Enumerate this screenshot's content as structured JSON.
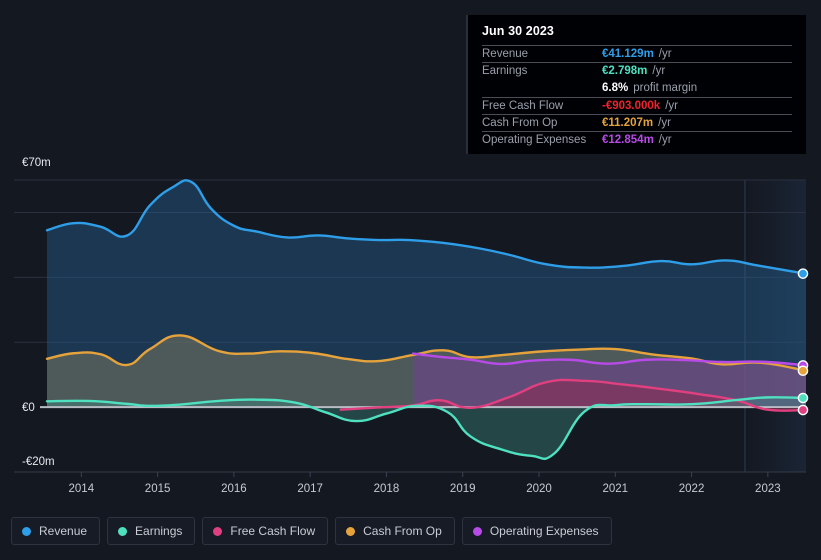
{
  "tooltip": {
    "date": "Jun 30 2023",
    "rows": [
      {
        "label": "Revenue",
        "value": "€41.129m",
        "unit": "/yr",
        "color": "#2f9ee8"
      },
      {
        "label": "Earnings",
        "value": "€2.798m",
        "unit": "/yr",
        "color": "#4fe0c0"
      },
      {
        "label": "",
        "value": "6.8%",
        "unit": "profit margin",
        "color": "#ffffff"
      },
      {
        "label": "Free Cash Flow",
        "value": "-€903.000k",
        "unit": "/yr",
        "color": "#f0222e"
      },
      {
        "label": "Cash From Op",
        "value": "€11.207m",
        "unit": "/yr",
        "color": "#e6a33c"
      },
      {
        "label": "Operating Expenses",
        "value": "€12.854m",
        "unit": "/yr",
        "color": "#b84ae8"
      }
    ]
  },
  "legend": {
    "items": [
      {
        "label": "Revenue",
        "color": "#2f9ee8"
      },
      {
        "label": "Earnings",
        "color": "#4fe0c0"
      },
      {
        "label": "Free Cash Flow",
        "color": "#e0407f"
      },
      {
        "label": "Cash From Op",
        "color": "#e6a33c"
      },
      {
        "label": "Operating Expenses",
        "color": "#b84ae8"
      }
    ]
  },
  "chart_data": {
    "type": "area",
    "title": "",
    "xlabel": "",
    "ylabel": "",
    "currency": "EUR",
    "grid": true,
    "legend_position": "bottom",
    "x_tick_labels": [
      "2014",
      "2015",
      "2016",
      "2017",
      "2018",
      "2019",
      "2020",
      "2021",
      "2022",
      "2023"
    ],
    "y_tick_labels": [
      "€70m",
      "€0",
      "-€20m"
    ],
    "ylim": [
      -20,
      70
    ],
    "y_gridline_values": [
      70,
      60,
      40,
      20,
      0,
      -20
    ],
    "zero_line": 0,
    "forecast_band_start_x": "2022.7",
    "series": [
      {
        "name": "Revenue",
        "color": "#2f9ee8",
        "fill": "rgba(37,99,150,0.42)",
        "x": [
          2013.55,
          2013.9,
          2014.25,
          2014.6,
          2014.9,
          2015.2,
          2015.45,
          2015.7,
          2016.0,
          2016.3,
          2016.7,
          2017.1,
          2017.5,
          2017.9,
          2018.3,
          2018.75,
          2019.2,
          2019.6,
          2020.1,
          2020.6,
          2021.1,
          2021.6,
          2022.0,
          2022.45,
          2022.9,
          2023.5
        ],
        "y": [
          54.5,
          56.7,
          55.6,
          52.9,
          62.2,
          67.8,
          69.3,
          61.2,
          55.9,
          54.1,
          52.3,
          52.9,
          52.0,
          51.5,
          51.5,
          50.6,
          49.0,
          47.0,
          44.0,
          43.0,
          43.5,
          45.0,
          44.0,
          45.2,
          43.5,
          41.1
        ]
      },
      {
        "name": "Cash From Op",
        "color": "#e6a33c",
        "fill": "rgba(120,118,95,0.55)",
        "x": [
          2013.55,
          2013.9,
          2014.25,
          2014.6,
          2014.9,
          2015.3,
          2015.8,
          2016.2,
          2016.6,
          2017.05,
          2017.5,
          2017.9,
          2018.35,
          2018.75,
          2019.1,
          2019.5,
          2020.0,
          2020.5,
          2021.0,
          2021.5,
          2022.0,
          2022.4,
          2022.9,
          2023.5
        ],
        "y": [
          14.9,
          16.6,
          16.3,
          13.0,
          17.9,
          22.1,
          17.3,
          16.5,
          17.2,
          16.6,
          14.8,
          14.2,
          16.1,
          17.5,
          15.4,
          16.0,
          17.1,
          17.7,
          17.9,
          16.2,
          15.0,
          13.2,
          13.7,
          11.2
        ]
      },
      {
        "name": "Operating Expenses",
        "color": "#b84ae8",
        "fill": "rgba(124,60,168,0.42)",
        "x": [
          2018.35,
          2018.7,
          2019.1,
          2019.5,
          2019.9,
          2020.4,
          2020.9,
          2021.4,
          2021.9,
          2022.4,
          2022.9,
          2023.5
        ],
        "y": [
          16.5,
          15.5,
          14.6,
          13.3,
          14.3,
          14.6,
          13.4,
          14.6,
          14.5,
          13.9,
          14.0,
          12.9
        ]
      },
      {
        "name": "Free Cash Flow",
        "color": "#e0407f",
        "fill": "rgba(150,35,70,0.45)",
        "x": [
          2017.4,
          2017.9,
          2018.35,
          2018.7,
          2019.1,
          2019.6,
          2020.1,
          2020.6,
          2021.1,
          2021.6,
          2022.1,
          2022.6,
          2023.0,
          2023.5
        ],
        "y": [
          -0.8,
          -0.1,
          0.5,
          2.1,
          -0.2,
          3.0,
          7.7,
          8.1,
          7.0,
          5.6,
          4.0,
          2.0,
          -0.8,
          -0.9
        ]
      },
      {
        "name": "Earnings",
        "color": "#4fe0c0",
        "fill": "rgba(60,140,130,0.40)",
        "x": [
          2013.55,
          2014.1,
          2014.6,
          2014.9,
          2015.3,
          2015.8,
          2016.3,
          2016.8,
          2017.2,
          2017.6,
          2018.0,
          2018.4,
          2018.8,
          2019.1,
          2019.5,
          2019.9,
          2020.2,
          2020.6,
          2021.0,
          2021.4,
          2022.0,
          2022.6,
          2023.0,
          2023.5
        ],
        "y": [
          1.8,
          1.9,
          1.0,
          0.4,
          0.8,
          1.9,
          2.3,
          1.4,
          -1.6,
          -4.3,
          -2.0,
          0.4,
          -1.5,
          -9.0,
          -13.0,
          -15.0,
          -14.3,
          -1.3,
          0.6,
          0.9,
          0.9,
          2.2,
          3.0,
          2.8
        ]
      }
    ],
    "endpoints": [
      {
        "series": "Revenue",
        "value": 41.129,
        "color": "#2f9ee8"
      },
      {
        "series": "Operating Expenses",
        "value": 12.854,
        "color": "#b84ae8"
      },
      {
        "series": "Cash From Op",
        "value": 11.207,
        "color": "#e6a33c"
      },
      {
        "series": "Earnings",
        "value": 2.798,
        "color": "#4fe0c0"
      },
      {
        "series": "Free Cash Flow",
        "value": -0.903,
        "color": "#e0407f"
      }
    ]
  }
}
